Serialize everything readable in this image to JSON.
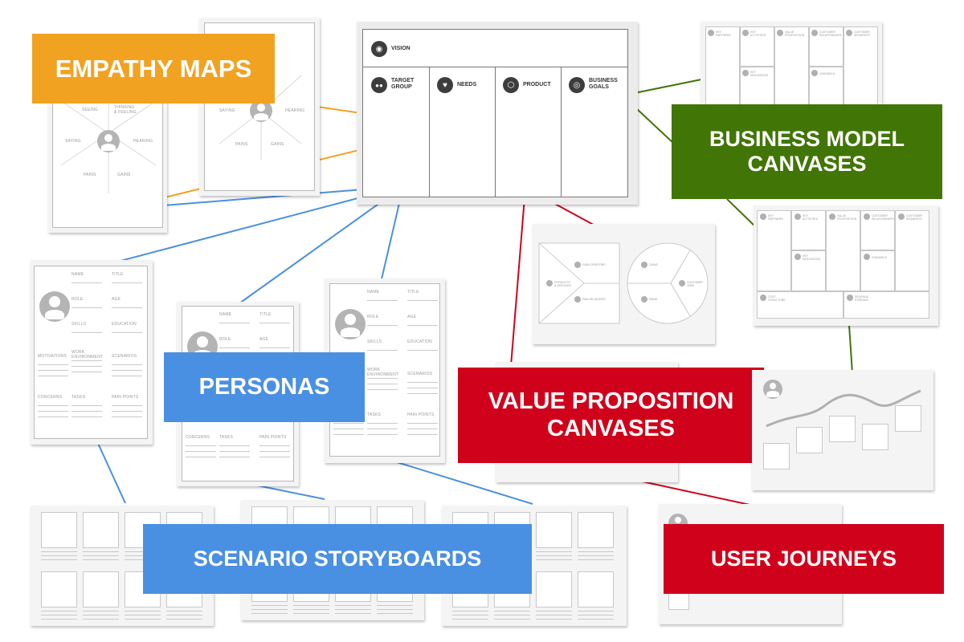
{
  "labels": {
    "empathy_maps": "EMPATHY MAPS",
    "business_model_line1": "BUSINESS MODEL",
    "business_model_line2": "CANVASES",
    "personas": "PERSONAS",
    "value_prop_line1": "VALUE PROPOSITION",
    "value_prop_line2": "CANVASES",
    "scenario_storyboards": "SCENARIO STORYBOARDS",
    "user_journeys": "USER JOURNEYS"
  },
  "colors": {
    "orange": "#f2a221",
    "green": "#417505",
    "blue": "#4a90e2",
    "red": "#d0021b"
  },
  "lean_canvas": {
    "vision": "VISION",
    "target_group_1": "TARGET",
    "target_group_2": "GROUP",
    "needs": "NEEDS",
    "product": "PRODUCT",
    "business_goals_1": "BUSINESS",
    "business_goals_2": "GOALS",
    "icons": [
      "eye-icon",
      "people-icon",
      "heart-icon",
      "cube-icon",
      "target-icon"
    ]
  },
  "empathy_map": {
    "seeing": "SEEING",
    "thinking_1": "THINKING",
    "thinking_2": "& FEELING",
    "saying": "SAYING",
    "hearing": "HEARING",
    "pains": "PAINS",
    "gains": "GAINS"
  },
  "persona": {
    "name": "NAME",
    "title": "TITLE",
    "role": "ROLE",
    "age": "AGE",
    "skills": "SKILLS",
    "education": "EDUCATION",
    "motivations": "MOTIVATIONS",
    "work_1": "WORK",
    "work_2": "ENVIRONMENT",
    "scenarios": "SCENARIOS",
    "concerns": "CONCERNS",
    "tasks": "TASKS",
    "pain_points": "PAIN POINTS"
  },
  "bmc": {
    "key_partners_1": "KEY",
    "key_partners_2": "PARTNERS",
    "key_activities_1": "KEY",
    "key_activities_2": "ACTIVITIES",
    "value_prop_1": "VALUE",
    "value_prop_2": "PROPOSITION",
    "cust_rel_1": "CUSTOMER",
    "cust_rel_2": "RELATIONSHIPS",
    "cust_seg_1": "CUSTOMER",
    "cust_seg_2": "SEGMENTS",
    "key_resources_1": "KEY",
    "key_resources_2": "RESOURCES",
    "channels": "CHANNELS",
    "cost_1": "COST",
    "cost_2": "STRUCTURE",
    "revenue_1": "REVENUE",
    "revenue_2": "STREAMS"
  },
  "vpc": {
    "gain_creators": "GAIN CREATORS",
    "products_1": "PRODUCTS",
    "products_2": "& SERVICES",
    "pain_relievers": "PAIN RELIEVERS",
    "gains": "GAINS",
    "pains": "PAINS",
    "customer_jobs_1": "CUSTOMER",
    "customer_jobs_2": "JOBS"
  }
}
